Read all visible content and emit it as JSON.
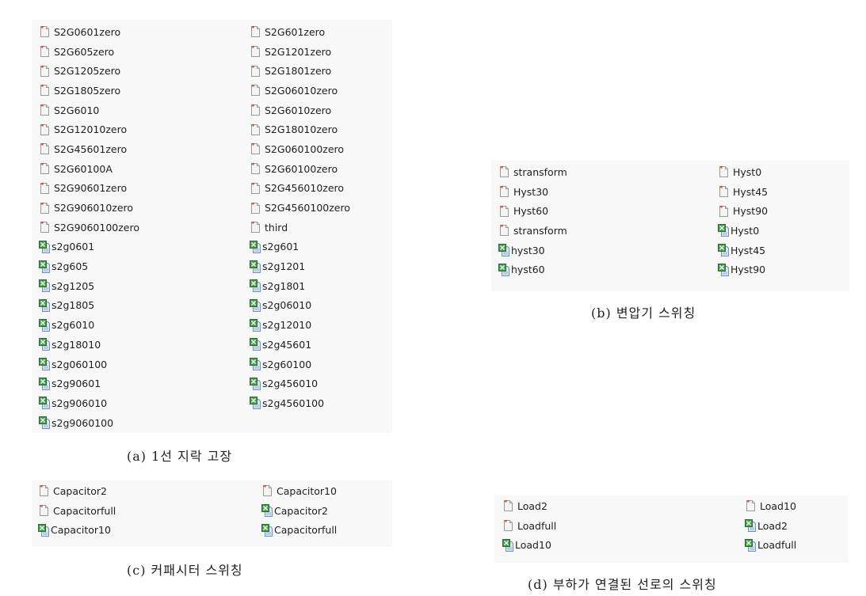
{
  "panels": {
    "a": {
      "caption": "(a) 1선 지락 고장",
      "left": [
        {
          "name": "S2G0601zero",
          "type": "doc"
        },
        {
          "name": "S2G605zero",
          "type": "doc"
        },
        {
          "name": "S2G1205zero",
          "type": "doc"
        },
        {
          "name": "S2G1805zero",
          "type": "doc"
        },
        {
          "name": "S2G6010",
          "type": "doc"
        },
        {
          "name": "S2G12010zero",
          "type": "doc"
        },
        {
          "name": "S2G45601zero",
          "type": "doc"
        },
        {
          "name": "S2G60100A",
          "type": "doc"
        },
        {
          "name": "S2G90601zero",
          "type": "doc"
        },
        {
          "name": "S2G906010zero",
          "type": "doc"
        },
        {
          "name": "S2G9060100zero",
          "type": "doc"
        },
        {
          "name": "s2g0601",
          "type": "excel"
        },
        {
          "name": "s2g605",
          "type": "excel"
        },
        {
          "name": "s2g1205",
          "type": "excel"
        },
        {
          "name": "s2g1805",
          "type": "excel"
        },
        {
          "name": "s2g6010",
          "type": "excel"
        },
        {
          "name": "s2g18010",
          "type": "excel"
        },
        {
          "name": "s2g060100",
          "type": "excel"
        },
        {
          "name": "s2g90601",
          "type": "excel"
        },
        {
          "name": "s2g906010",
          "type": "excel"
        },
        {
          "name": "s2g9060100",
          "type": "excel"
        }
      ],
      "right": [
        {
          "name": "S2G601zero",
          "type": "doc"
        },
        {
          "name": "S2G1201zero",
          "type": "doc"
        },
        {
          "name": "S2G1801zero",
          "type": "doc"
        },
        {
          "name": "S2G06010zero",
          "type": "doc"
        },
        {
          "name": "S2G6010zero",
          "type": "doc"
        },
        {
          "name": "S2G18010zero",
          "type": "doc"
        },
        {
          "name": "S2G060100zero",
          "type": "doc"
        },
        {
          "name": "S2G60100zero",
          "type": "doc"
        },
        {
          "name": "S2G456010zero",
          "type": "doc"
        },
        {
          "name": "S2G4560100zero",
          "type": "doc"
        },
        {
          "name": "third",
          "type": "doc"
        },
        {
          "name": "s2g601",
          "type": "excel"
        },
        {
          "name": "s2g1201",
          "type": "excel"
        },
        {
          "name": "s2g1801",
          "type": "excel"
        },
        {
          "name": "s2g06010",
          "type": "excel"
        },
        {
          "name": "s2g12010",
          "type": "excel"
        },
        {
          "name": "s2g45601",
          "type": "excel"
        },
        {
          "name": "s2g60100",
          "type": "excel"
        },
        {
          "name": "s2g456010",
          "type": "excel"
        },
        {
          "name": "s2g4560100",
          "type": "excel"
        }
      ]
    },
    "b": {
      "caption": "(b) 변압기 스위칭",
      "left": [
        {
          "name": "stransform",
          "type": "doc"
        },
        {
          "name": "Hyst30",
          "type": "doc"
        },
        {
          "name": "Hyst60",
          "type": "doc"
        },
        {
          "name": "stransform",
          "type": "doc"
        },
        {
          "name": "hyst30",
          "type": "excel"
        },
        {
          "name": "hyst60",
          "type": "excel"
        }
      ],
      "right": [
        {
          "name": "Hyst0",
          "type": "doc"
        },
        {
          "name": "Hyst45",
          "type": "doc"
        },
        {
          "name": "Hyst90",
          "type": "doc"
        },
        {
          "name": "Hyst0",
          "type": "excel"
        },
        {
          "name": "Hyst45",
          "type": "excel"
        },
        {
          "name": "Hyst90",
          "type": "excel"
        }
      ]
    },
    "c": {
      "caption": "(c) 커패시터 스위칭",
      "left": [
        {
          "name": "Capacitor2",
          "type": "doc"
        },
        {
          "name": "Capacitorfull",
          "type": "doc"
        },
        {
          "name": "Capacitor10",
          "type": "excel"
        }
      ],
      "right": [
        {
          "name": "Capacitor10",
          "type": "doc"
        },
        {
          "name": "Capacitor2",
          "type": "excel"
        },
        {
          "name": "Capacitorfull",
          "type": "excel"
        }
      ]
    },
    "d": {
      "caption": "(d) 부하가 연결된 선로의 스위칭",
      "left": [
        {
          "name": "Load2",
          "type": "doc"
        },
        {
          "name": "Loadfull",
          "type": "doc"
        },
        {
          "name": "Load10",
          "type": "excel"
        }
      ],
      "right": [
        {
          "name": "Load10",
          "type": "doc"
        },
        {
          "name": "Load2",
          "type": "excel"
        },
        {
          "name": "Loadfull",
          "type": "excel"
        }
      ]
    }
  },
  "icons": {
    "doc": "generic-file-icon",
    "excel": "excel-file-icon"
  },
  "colors": {
    "panel_bg": "#f8f8f8",
    "excel_green": "#2e8b3a",
    "doc_red": "#c0392b"
  }
}
